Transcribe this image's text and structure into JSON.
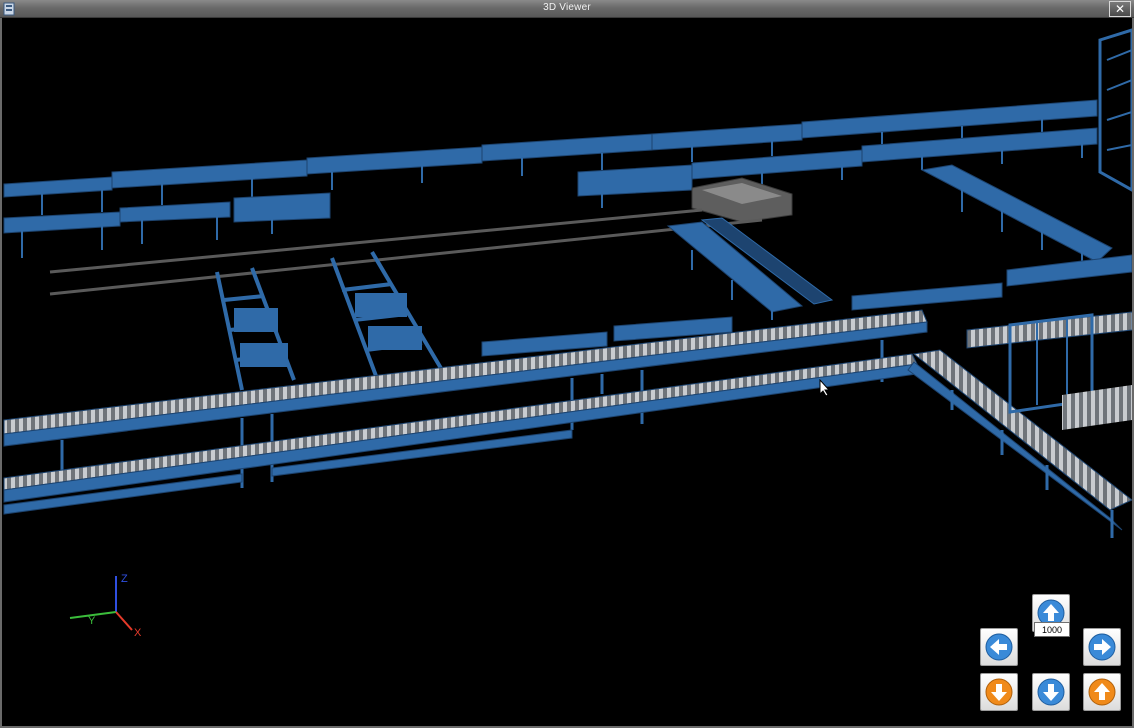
{
  "window": {
    "title": "3D Viewer",
    "close_symbol": "✕"
  },
  "icons": {
    "app": "app-icon",
    "close": "close-icon",
    "up": "arrow-up-icon",
    "down": "arrow-down-icon",
    "left": "arrow-left-icon",
    "right": "arrow-right-icon",
    "zoom_in": "zoom-in-icon",
    "zoom_out": "zoom-out-icon"
  },
  "axes": {
    "x_label": "X",
    "y_label": "Y",
    "z_label": "Z",
    "x_color": "#e53a2a",
    "y_color": "#3bbd3b",
    "z_color": "#2f4fe0"
  },
  "navigation": {
    "step_value": "1000"
  },
  "colors": {
    "frame": "#2f6aa8",
    "frame_dark": "#1d4470",
    "rollers": "#b8bcc2",
    "rail": "#5a5a5a",
    "machine": "#6a6a6a",
    "blue_button": "#3a8ad8",
    "orange_button": "#f08a1a"
  }
}
